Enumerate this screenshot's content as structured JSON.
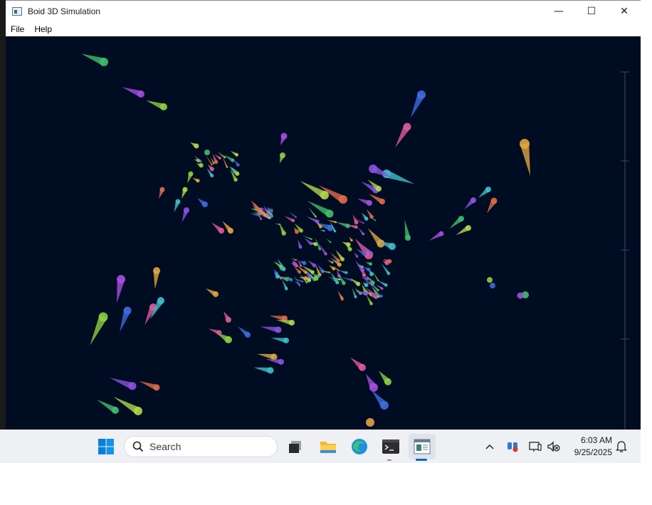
{
  "window": {
    "title": "Boid 3D Simulation",
    "controls": {
      "minimize": "—",
      "maximize": "☐",
      "close": "✕"
    }
  },
  "menu": {
    "items": [
      "File",
      "Help"
    ]
  },
  "simulation": {
    "background_color": "#000c22",
    "palette": [
      "#3fbf6a",
      "#a64de0",
      "#8bd13f",
      "#3d6de0",
      "#e05a9a",
      "#e0a53f",
      "#3fbfc8",
      "#8a52e0",
      "#e06a4a",
      "#b0d84a"
    ]
  },
  "taskbar": {
    "search_placeholder": "Search",
    "clock": {
      "time": "6:03 AM",
      "date": "9/25/2025"
    },
    "apps": [
      "start-icon",
      "task-view-icon",
      "file-explorer-icon",
      "edge-icon",
      "terminal-icon",
      "boid-sim-app-icon"
    ],
    "tray": [
      "chevron-up-icon",
      "tray-app-icon",
      "network-icon",
      "volume-muted-icon",
      "notification-icon"
    ]
  }
}
